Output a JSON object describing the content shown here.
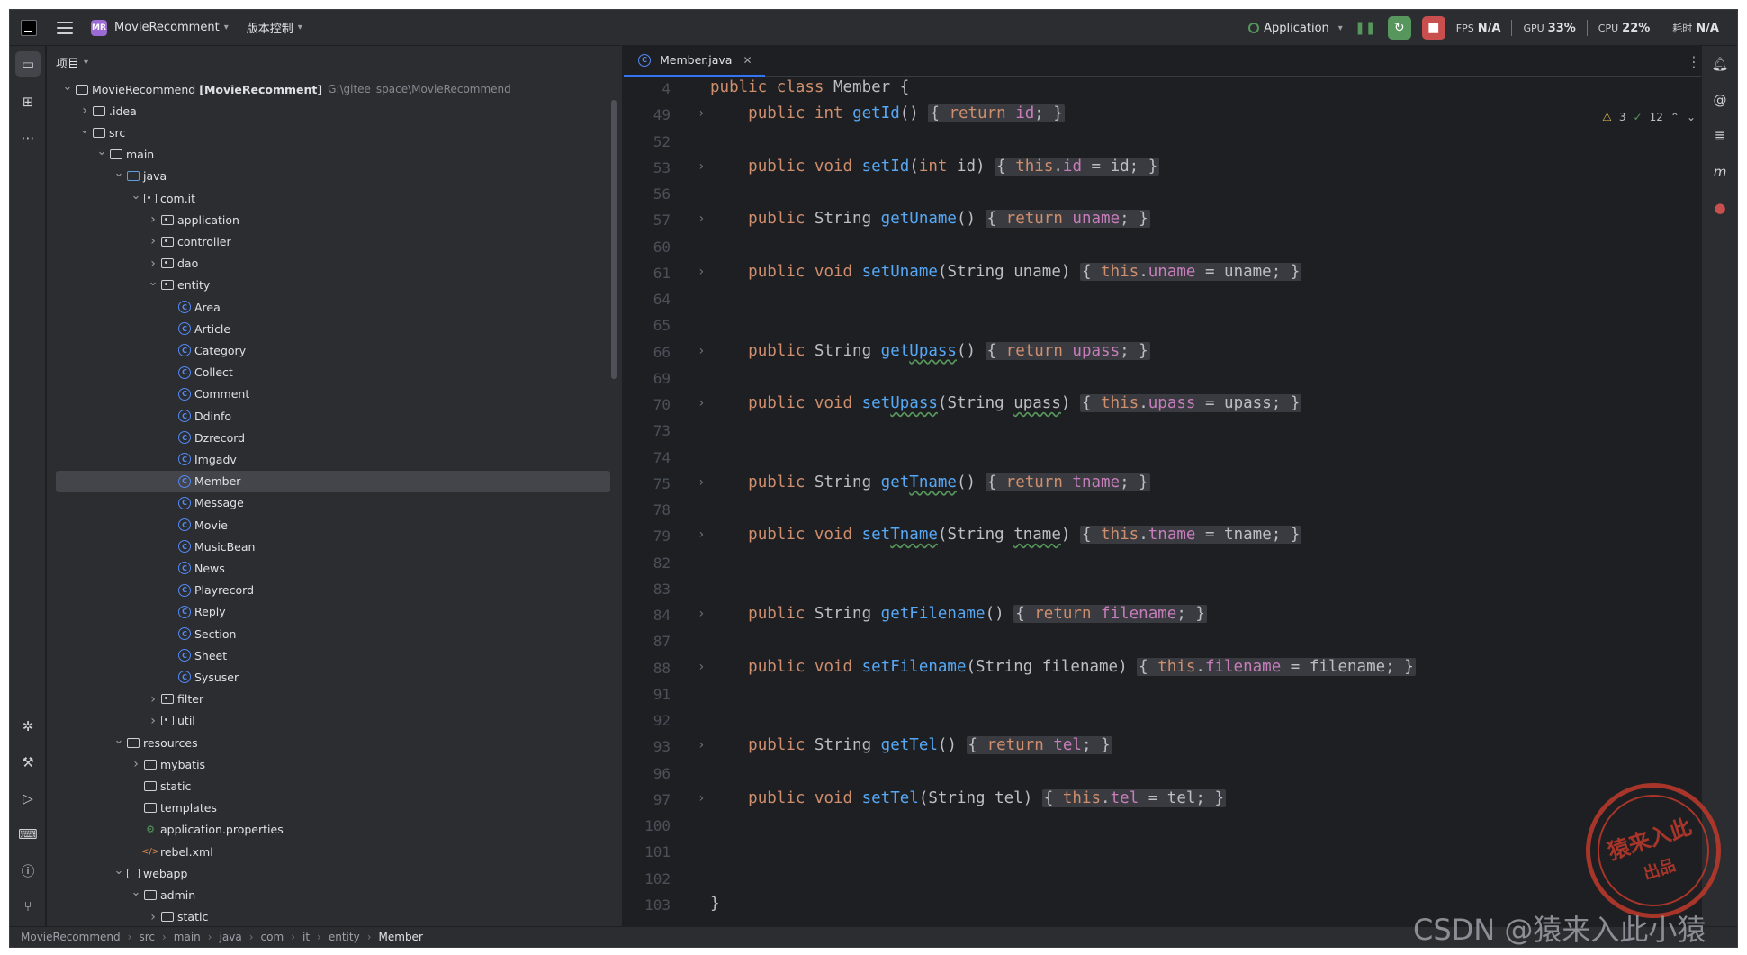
{
  "titlebar": {
    "project_badge": "MR",
    "project_name": "MovieRecomment",
    "vcs_label": "版本控制",
    "run_config": "Application",
    "fps_label": "FPS",
    "fps_value": "N/A",
    "gpu_label": "GPU",
    "gpu_value": "33%",
    "cpu_label": "CPU",
    "cpu_value": "22%",
    "time_label": "耗时",
    "time_value": "N/A"
  },
  "project_panel": {
    "title": "项目",
    "tree": [
      {
        "label": "MovieRecommend",
        "bold": "[MovieRecomment]",
        "path": "G:\\gitee_space\\MovieRecommend",
        "level": 0,
        "arrow": "open",
        "icon": "folder"
      },
      {
        "label": ".idea",
        "level": 1,
        "arrow": "closed",
        "icon": "folder"
      },
      {
        "label": "src",
        "level": 1,
        "arrow": "open",
        "icon": "folder"
      },
      {
        "label": "main",
        "level": 2,
        "arrow": "open",
        "icon": "folder"
      },
      {
        "label": "java",
        "level": 3,
        "arrow": "open",
        "icon": "folder-src"
      },
      {
        "label": "com.it",
        "level": 4,
        "arrow": "open",
        "icon": "package"
      },
      {
        "label": "application",
        "level": 5,
        "arrow": "closed",
        "icon": "package"
      },
      {
        "label": "controller",
        "level": 5,
        "arrow": "closed",
        "icon": "package"
      },
      {
        "label": "dao",
        "level": 5,
        "arrow": "closed",
        "icon": "package"
      },
      {
        "label": "entity",
        "level": 5,
        "arrow": "open",
        "icon": "package"
      },
      {
        "label": "Area",
        "level": 6,
        "arrow": "none",
        "icon": "class"
      },
      {
        "label": "Article",
        "level": 6,
        "arrow": "none",
        "icon": "class"
      },
      {
        "label": "Category",
        "level": 6,
        "arrow": "none",
        "icon": "class"
      },
      {
        "label": "Collect",
        "level": 6,
        "arrow": "none",
        "icon": "class"
      },
      {
        "label": "Comment",
        "level": 6,
        "arrow": "none",
        "icon": "class"
      },
      {
        "label": "Ddinfo",
        "level": 6,
        "arrow": "none",
        "icon": "class"
      },
      {
        "label": "Dzrecord",
        "level": 6,
        "arrow": "none",
        "icon": "class"
      },
      {
        "label": "Imgadv",
        "level": 6,
        "arrow": "none",
        "icon": "class"
      },
      {
        "label": "Member",
        "level": 6,
        "arrow": "none",
        "icon": "class",
        "selected": true
      },
      {
        "label": "Message",
        "level": 6,
        "arrow": "none",
        "icon": "class"
      },
      {
        "label": "Movie",
        "level": 6,
        "arrow": "none",
        "icon": "class"
      },
      {
        "label": "MusicBean",
        "level": 6,
        "arrow": "none",
        "icon": "class"
      },
      {
        "label": "News",
        "level": 6,
        "arrow": "none",
        "icon": "class"
      },
      {
        "label": "Playrecord",
        "level": 6,
        "arrow": "none",
        "icon": "class"
      },
      {
        "label": "Reply",
        "level": 6,
        "arrow": "none",
        "icon": "class"
      },
      {
        "label": "Section",
        "level": 6,
        "arrow": "none",
        "icon": "class"
      },
      {
        "label": "Sheet",
        "level": 6,
        "arrow": "none",
        "icon": "class"
      },
      {
        "label": "Sysuser",
        "level": 6,
        "arrow": "none",
        "icon": "class"
      },
      {
        "label": "filter",
        "level": 5,
        "arrow": "closed",
        "icon": "package"
      },
      {
        "label": "util",
        "level": 5,
        "arrow": "closed",
        "icon": "package"
      },
      {
        "label": "resources",
        "level": 3,
        "arrow": "open",
        "icon": "folder"
      },
      {
        "label": "mybatis",
        "level": 4,
        "arrow": "closed",
        "icon": "folder"
      },
      {
        "label": "static",
        "level": 4,
        "arrow": "none",
        "icon": "folder"
      },
      {
        "label": "templates",
        "level": 4,
        "arrow": "none",
        "icon": "folder"
      },
      {
        "label": "application.properties",
        "level": 4,
        "arrow": "none",
        "icon": "properties"
      },
      {
        "label": "rebel.xml",
        "level": 4,
        "arrow": "none",
        "icon": "xml"
      },
      {
        "label": "webapp",
        "level": 3,
        "arrow": "open",
        "icon": "folder"
      },
      {
        "label": "admin",
        "level": 4,
        "arrow": "open",
        "icon": "folder"
      },
      {
        "label": "static",
        "level": 5,
        "arrow": "closed",
        "icon": "folder"
      }
    ]
  },
  "editor": {
    "tab_label": "Member.java",
    "inspections": {
      "warnings": "3",
      "checks": "12"
    },
    "lines": [
      {
        "n": "4",
        "fold": false,
        "html": "<span class='kw'>public class</span> Member {"
      },
      {
        "n": "49",
        "fold": true,
        "html": "    <span class='kw'>public int</span> <span class='fn'>getId</span>() <span class='fold'>{ <span class='kw'>return</span> <span class='fld'>id</span>; }</span>"
      },
      {
        "n": "52",
        "fold": false,
        "html": ""
      },
      {
        "n": "53",
        "fold": true,
        "html": "    <span class='kw'>public void</span> <span class='fn'>setId</span>(<span class='kw'>int</span> id) <span class='fold'>{ <span class='kw'>this</span>.<span class='fld'>id</span> = id; }</span>"
      },
      {
        "n": "56",
        "fold": false,
        "html": ""
      },
      {
        "n": "57",
        "fold": true,
        "html": "    <span class='kw'>public</span> String <span class='fn'>getUname</span>() <span class='fold'>{ <span class='kw'>return</span> <span class='fld'>uname</span>; }</span>"
      },
      {
        "n": "60",
        "fold": false,
        "html": ""
      },
      {
        "n": "61",
        "fold": true,
        "html": "    <span class='kw'>public void</span> <span class='fn'>setUname</span>(String uname) <span class='fold'>{ <span class='kw'>this</span>.<span class='fld'>uname</span> = uname; }</span>"
      },
      {
        "n": "64",
        "fold": false,
        "html": ""
      },
      {
        "n": "65",
        "fold": false,
        "html": ""
      },
      {
        "n": "66",
        "fold": true,
        "html": "    <span class='kw'>public</span> String <span class='fn'>get<span class='sq'>Upass</span></span>() <span class='fold'>{ <span class='kw'>return</span> <span class='fld'>upass</span>; }</span>"
      },
      {
        "n": "69",
        "fold": false,
        "html": ""
      },
      {
        "n": "70",
        "fold": true,
        "html": "    <span class='kw'>public void</span> <span class='fn'>set<span class='sq'>Upass</span></span>(String <span class='sq'>upass</span>) <span class='fold'>{ <span class='kw'>this</span>.<span class='fld'>upass</span> = upass; }</span>"
      },
      {
        "n": "73",
        "fold": false,
        "html": ""
      },
      {
        "n": "74",
        "fold": false,
        "html": ""
      },
      {
        "n": "75",
        "fold": true,
        "html": "    <span class='kw'>public</span> String <span class='fn'>get<span class='sq'>Tname</span></span>() <span class='fold'>{ <span class='kw'>return</span> <span class='fld'>tname</span>; }</span>"
      },
      {
        "n": "78",
        "fold": false,
        "html": ""
      },
      {
        "n": "79",
        "fold": true,
        "html": "    <span class='kw'>public void</span> <span class='fn'>set<span class='sq'>Tname</span></span>(String <span class='sq'>tname</span>) <span class='fold'>{ <span class='kw'>this</span>.<span class='fld'>tname</span> = tname; }</span>"
      },
      {
        "n": "82",
        "fold": false,
        "html": ""
      },
      {
        "n": "83",
        "fold": false,
        "html": ""
      },
      {
        "n": "84",
        "fold": true,
        "html": "    <span class='kw'>public</span> String <span class='fn'>getFilename</span>() <span class='fold'>{ <span class='kw'>return</span> <span class='fld'>filename</span>; }</span>"
      },
      {
        "n": "87",
        "fold": false,
        "html": ""
      },
      {
        "n": "88",
        "fold": true,
        "html": "    <span class='kw'>public void</span> <span class='fn'>setFilename</span>(String filename) <span class='fold'>{ <span class='kw'>this</span>.<span class='fld'>filename</span> = filename; }</span>"
      },
      {
        "n": "91",
        "fold": false,
        "html": ""
      },
      {
        "n": "92",
        "fold": false,
        "html": ""
      },
      {
        "n": "93",
        "fold": true,
        "html": "    <span class='kw'>public</span> String <span class='fn'>getTel</span>() <span class='fold'>{ <span class='kw'>return</span> <span class='fld'>tel</span>; }</span>"
      },
      {
        "n": "96",
        "fold": false,
        "html": ""
      },
      {
        "n": "97",
        "fold": true,
        "html": "    <span class='kw'>public void</span> <span class='fn'>setTel</span>(String tel) <span class='fold'>{ <span class='kw'>this</span>.<span class='fld'>tel</span> = tel; }</span>"
      },
      {
        "n": "100",
        "fold": false,
        "html": ""
      },
      {
        "n": "101",
        "fold": false,
        "html": ""
      },
      {
        "n": "102",
        "fold": false,
        "html": ""
      },
      {
        "n": "103",
        "fold": false,
        "html": "}"
      }
    ]
  },
  "statusbar": {
    "breadcrumbs": [
      "MovieRecommend",
      "src",
      "main",
      "java",
      "com",
      "it",
      "entity",
      "Member"
    ]
  },
  "watermark": {
    "seal_line1": "猿来入此",
    "seal_line2": "出品",
    "csdn": "CSDN @猿来入此小猿"
  }
}
